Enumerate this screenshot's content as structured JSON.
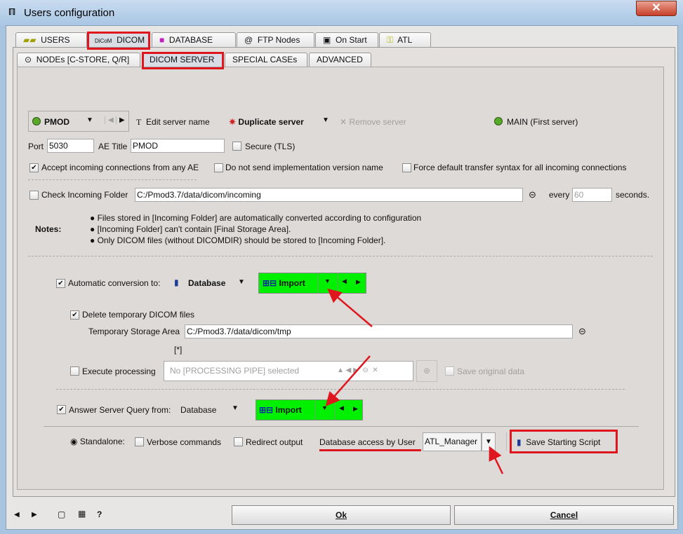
{
  "window": {
    "title": "Users configuration",
    "close_label": "✕"
  },
  "tabs": [
    {
      "label": "USERS",
      "icon": "users-icon"
    },
    {
      "label": "DICOM",
      "icon": "dicom-icon"
    },
    {
      "label": "DATABASE",
      "icon": "database-icon"
    },
    {
      "label": "FTP Nodes",
      "icon": "at-icon"
    },
    {
      "label": "On Start",
      "icon": "clipboard-icon"
    },
    {
      "label": "ATL",
      "icon": "key-icon"
    }
  ],
  "subtabs": [
    {
      "label": "NODEs [C-STORE, Q/R]"
    },
    {
      "label": "DICOM SERVER"
    },
    {
      "label": "SPECIAL CASEs"
    },
    {
      "label": "ADVANCED"
    }
  ],
  "server": {
    "selected": "PMOD",
    "edit_name": "Edit server name",
    "duplicate": "Duplicate server",
    "remove": "Remove server",
    "main": "MAIN (First server)"
  },
  "connection": {
    "port_label": "Port",
    "port": "5030",
    "ae_label": "AE Title",
    "ae": "PMOD",
    "secure": "Secure (TLS)",
    "accept_any": "Accept incoming connections from any AE",
    "no_impl": "Do not send implementation version name",
    "force_syntax": "Force default transfer syntax for all incoming connections"
  },
  "incoming": {
    "label": "Check Incoming Folder",
    "path": "C:/Pmod3.7/data/dicom/incoming",
    "every": "every",
    "interval": "60",
    "seconds": "seconds."
  },
  "notes": {
    "label": "Notes:",
    "items": [
      "Files stored in [Incoming Folder] are automatically converted according to configuration",
      "[Incoming Folder] can't contain [Final Storage Area].",
      "Only DICOM files (without DICOMDIR) should be stored to [Incoming Folder]."
    ]
  },
  "conversion": {
    "label": "Automatic conversion to:",
    "target": "Database",
    "import": "Import",
    "delete_tmp": "Delete temporary DICOM files",
    "tmp_label": "Temporary Storage Area",
    "tmp_path": "C:/Pmod3.7/data/dicom/tmp",
    "marker": "[*]",
    "exec_label": "Execute processing",
    "pipe": "No [PROCESSING PIPE] selected",
    "save_original": "Save original data"
  },
  "query": {
    "label": "Answer Server Query from:",
    "source": "Database",
    "import": "Import"
  },
  "bottom": {
    "standalone": "Standalone:",
    "verbose": "Verbose commands",
    "redirect": "Redirect output",
    "db_user_label": "Database access by User",
    "db_user": "ATL_Manager",
    "save_script": "Save Starting Script"
  },
  "footer": {
    "ok": "Ok",
    "cancel": "Cancel",
    "help": "?"
  },
  "colors": {
    "accent_green": "#00f000",
    "annotation_red": "#e0161e",
    "status_green": "#59a829"
  }
}
